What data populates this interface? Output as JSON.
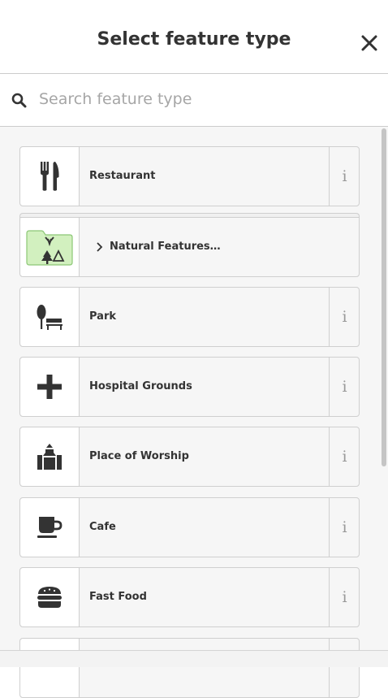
{
  "header": {
    "title": "Select feature type",
    "close_icon": "close-icon"
  },
  "search": {
    "placeholder": "Search feature type",
    "value": "",
    "icon": "search-icon"
  },
  "presets": [
    {
      "label": "Restaurant",
      "icon": "fork-knife-icon",
      "info": "i"
    },
    {
      "label": "Natural Features…",
      "icon": "folder-nature-icon",
      "category": true
    },
    {
      "label": "Park",
      "icon": "tree-bench-icon",
      "info": "i"
    },
    {
      "label": "Hospital Grounds",
      "icon": "plus-icon",
      "info": "i"
    },
    {
      "label": "Place of Worship",
      "icon": "place-of-worship-icon",
      "info": "i"
    },
    {
      "label": "Cafe",
      "icon": "coffee-cup-icon",
      "info": "i"
    },
    {
      "label": "Fast Food",
      "icon": "burger-icon",
      "info": "i"
    }
  ],
  "colors": {
    "category_folder_fill": "#d2f0bf",
    "category_folder_stroke": "#8cc776",
    "icon_fill": "#333333",
    "info_color": "#999999"
  }
}
